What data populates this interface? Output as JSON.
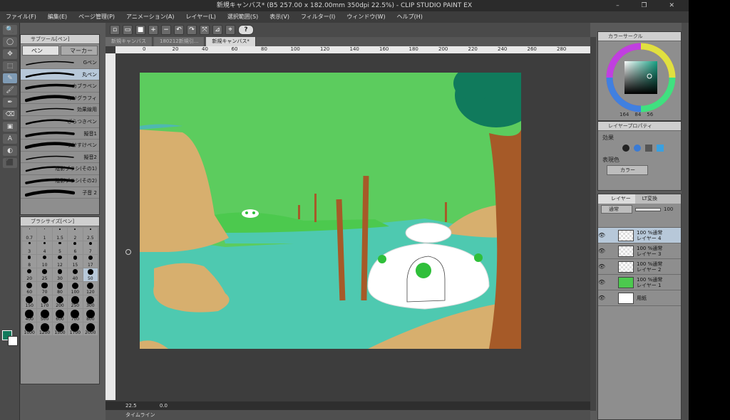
{
  "window": {
    "title": "新規キャンバス* (B5 257.00 x 182.00mm 350dpi 22.5%) - CLIP STUDIO PAINT EX",
    "controls": "–  ❐  ✕"
  },
  "menu": [
    "ファイル(F)",
    "編集(E)",
    "ページ管理(P)",
    "アニメーション(A)",
    "レイヤー(L)",
    "選択範囲(S)",
    "表示(V)",
    "フィルター(I)",
    "ウィンドウ(W)",
    "ヘルプ(H)"
  ],
  "command_bar": {
    "help_label": "?"
  },
  "tools": [
    "🔍",
    "◯",
    "✥",
    "⬚",
    "✎",
    "🖌",
    "✒",
    "⌫",
    "▣",
    "A",
    "◐",
    "⬛"
  ],
  "subtool_panel": {
    "title": "サブツール[ペン]",
    "tabs": [
      "ペン",
      "マーカー"
    ],
    "brushes": [
      "Gペン",
      "丸ペン",
      "カブラペン",
      "カリグラフィ",
      "効果線用",
      "ざらつきペン",
      "擬音1",
      "すけすけペン",
      "擬音2",
      "陰影ブラシ(その1)",
      "陰影ブラシ(その2)",
      "子音 2"
    ],
    "selected_brush": "丸ペン"
  },
  "brush_size_panel": {
    "title": "ブラシサイズ[ペン]",
    "sizes": [
      "0.7",
      "1",
      "1.5",
      "2",
      "2.5",
      "3",
      "4",
      "5",
      "6",
      "7",
      "8",
      "10",
      "12",
      "15",
      "17",
      "20",
      "25",
      "30",
      "40",
      "50",
      "60",
      "70",
      "80",
      "100",
      "120",
      "150",
      "170",
      "200",
      "250",
      "300",
      "400",
      "500",
      "600",
      "700",
      "800",
      "1000",
      "1200",
      "1500",
      "1700",
      "2000"
    ],
    "selected": "50"
  },
  "document": {
    "tabs": [
      "新規キャンバス",
      "180212新規引...",
      "新規キャンバス*"
    ],
    "active_tab": "新規キャンバス*",
    "ruler_ticks": [
      "0",
      "20",
      "40",
      "60",
      "80",
      "100",
      "120",
      "140",
      "160",
      "180",
      "200",
      "220",
      "240",
      "260",
      "280"
    ],
    "zoom": "22.5",
    "rotation": "0.0",
    "timeline_label": "タイムライン"
  },
  "color_wheel": {
    "title": "カラーサークル",
    "h": "164",
    "s": "84",
    "v": "56"
  },
  "layer_property": {
    "title": "レイヤープロパティ",
    "effect_label": "効果",
    "expression_label": "表現色",
    "expression_value": "カラー"
  },
  "layer_panel": {
    "tabs": [
      "レイヤー",
      "LT変換"
    ],
    "blend": "通常",
    "opacity": "100",
    "layers": [
      {
        "name": "100 %通常\nレイヤー 4",
        "selected": true
      },
      {
        "name": "100 %通常\nレイヤー 3",
        "selected": false
      },
      {
        "name": "100 %通常\nレイヤー 2",
        "selected": false
      },
      {
        "name": "100 %通常\nレイヤー 1",
        "selected": false
      },
      {
        "name": "用紙",
        "selected": false
      }
    ]
  },
  "colors": {
    "accent": "#b7c8d9",
    "canvas_sky": "#5ccc5e",
    "water": "#4ec9b0",
    "sand": "#d7af6e",
    "trunk": "#a65a28",
    "foliage": "#107a5c",
    "dome": "#ffffff"
  }
}
